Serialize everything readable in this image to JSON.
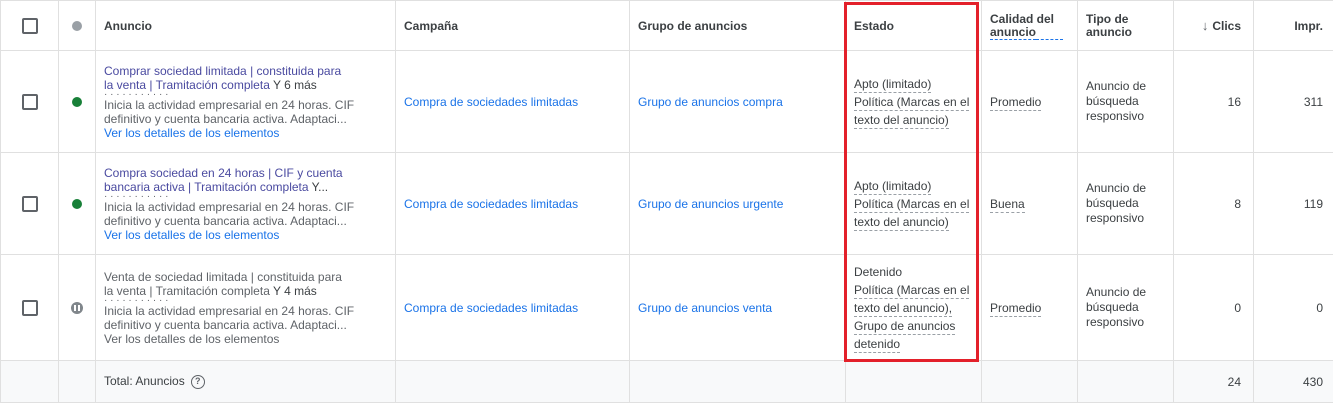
{
  "columns": {
    "anuncio": "Anuncio",
    "campana": "Campaña",
    "grupo": "Grupo de anuncios",
    "estado": "Estado",
    "calidad_line1": "Calidad del",
    "calidad_line2": "anuncio",
    "tipo_line1": "Tipo de",
    "tipo_line2": "anuncio",
    "clics": "Clics",
    "impr": "Impr."
  },
  "rows": [
    {
      "title_line1": "Comprar sociedad limitada | constituida para",
      "title_line2": "la venta | Tramitación completa",
      "title_more": "Y 6 más",
      "garble": "· · · · · · · · · · ·",
      "desc_line1": "Inicia la actividad empresarial en 24 horas. CIF",
      "desc_line2": "definitivo y cuenta bancaria activa. Adaptaci...",
      "details": "Ver los detalles de los elementos",
      "campaign": "Compra de sociedades limitadas",
      "ad_group": "Grupo de anuncios compra",
      "status": [
        "Apto (limitado)",
        "Política (Marcas en el",
        "texto del anuncio)"
      ],
      "quality": "Promedio",
      "type": [
        "Anuncio de",
        "búsqueda",
        "responsivo"
      ],
      "clicks": "16",
      "impressions": "311"
    },
    {
      "title_line1": "Compra sociedad en 24 horas | CIF y cuenta",
      "title_line2": "bancaria activa | Tramitación completa",
      "title_more": "Y...",
      "garble": "· · · · · · · · · · ·",
      "desc_line1": "Inicia la actividad empresarial en 24 horas. CIF",
      "desc_line2": "definitivo y cuenta bancaria activa. Adaptaci...",
      "details": "Ver los detalles de los elementos",
      "campaign": "Compra de sociedades limitadas",
      "ad_group": "Grupo de anuncios urgente",
      "status": [
        "Apto (limitado)",
        "Política (Marcas en el",
        "texto del anuncio)"
      ],
      "quality": "Buena",
      "type": [
        "Anuncio de",
        "búsqueda",
        "responsivo"
      ],
      "clicks": "8",
      "impressions": "119"
    },
    {
      "title_line1": "Venta de sociedad limitada | constituida para",
      "title_line2": "la venta | Tramitación completa",
      "title_more": "Y 4 más",
      "garble": "· · · · · · · · · · ·",
      "desc_line1": "Inicia la actividad empresarial en 24 horas. CIF",
      "desc_line2": "definitivo y cuenta bancaria activa. Adaptaci...",
      "details": "Ver los detalles de los elementos",
      "campaign": "Compra de sociedades limitadas",
      "ad_group": "Grupo de anuncios venta",
      "status": [
        "Detenido",
        "Política (Marcas en el",
        "texto del anuncio),",
        "Grupo de anuncios",
        "detenido"
      ],
      "quality": "Promedio",
      "type": [
        "Anuncio de",
        "búsqueda",
        "responsivo"
      ],
      "clicks": "0",
      "impressions": "0"
    }
  ],
  "total": {
    "label": "Total: Anuncios",
    "help": "?",
    "clicks": "24",
    "impressions": "430"
  },
  "colors": {
    "enabled": "#188038",
    "paused": "#80868b",
    "link": "#1a73e8",
    "highlight": "#e3202a"
  }
}
